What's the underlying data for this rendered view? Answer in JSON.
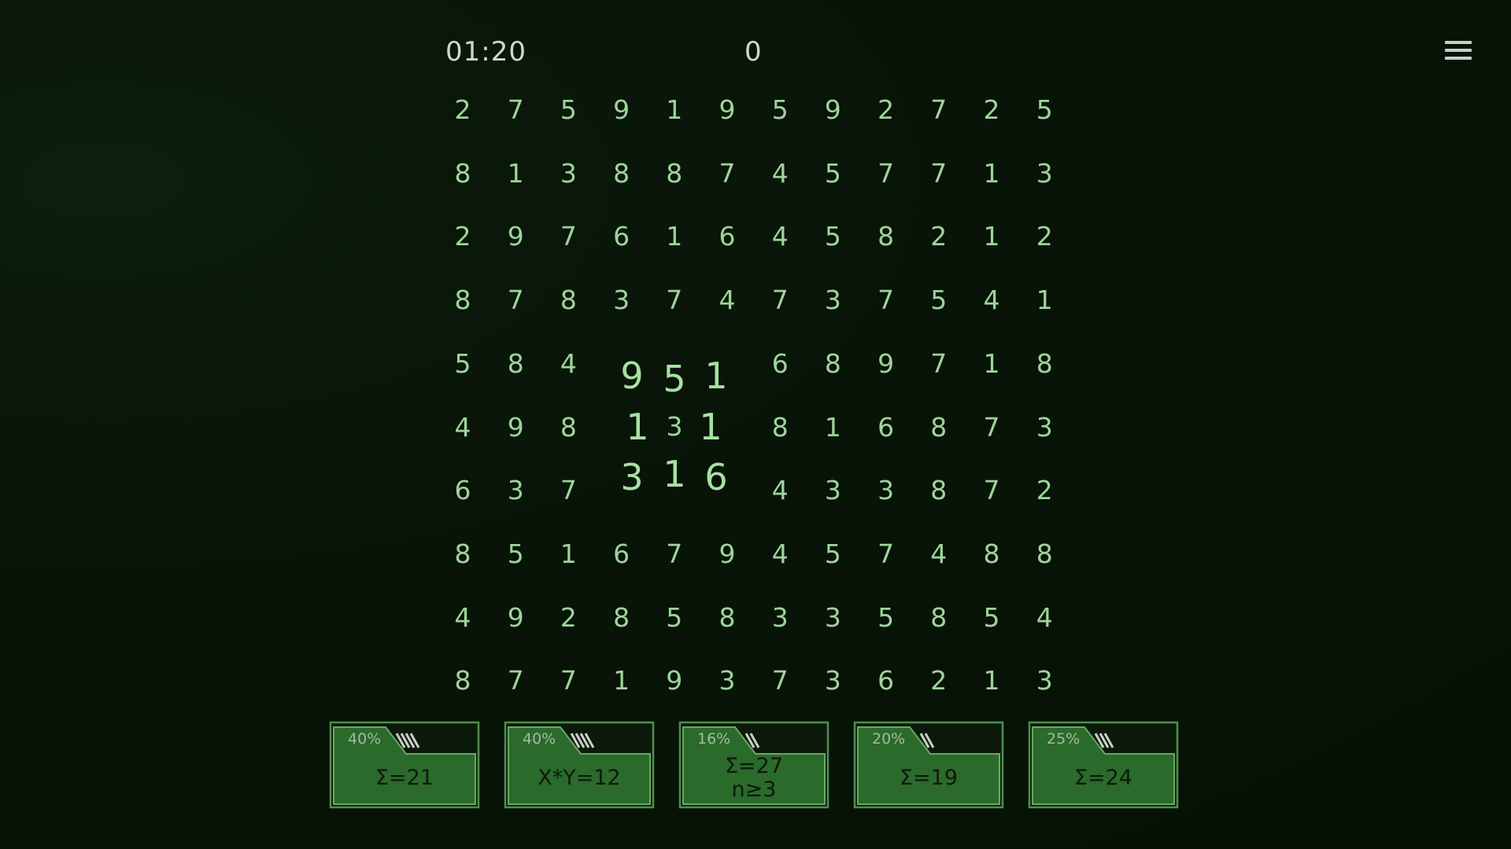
{
  "hud": {
    "timer": "01:20",
    "score": "0",
    "menu_icon": "hamburger-menu-icon"
  },
  "grid": {
    "rows": [
      [
        "2",
        "7",
        "5",
        "9",
        "1",
        "9",
        "5",
        "9",
        "2",
        "7",
        "2",
        "5"
      ],
      [
        "8",
        "1",
        "3",
        "8",
        "8",
        "7",
        "4",
        "5",
        "7",
        "7",
        "1",
        "3"
      ],
      [
        "2",
        "9",
        "7",
        "6",
        "1",
        "6",
        "4",
        "5",
        "8",
        "2",
        "1",
        "2"
      ],
      [
        "8",
        "7",
        "8",
        "3",
        "7",
        "4",
        "7",
        "3",
        "7",
        "5",
        "4",
        "1"
      ],
      [
        "5",
        "8",
        "4",
        "9",
        "5",
        "1",
        "6",
        "8",
        "9",
        "7",
        "1",
        "8"
      ],
      [
        "4",
        "9",
        "8",
        "1",
        "3",
        "1",
        "8",
        "1",
        "6",
        "8",
        "7",
        "3"
      ],
      [
        "6",
        "3",
        "7",
        "3",
        "1",
        "6",
        "4",
        "3",
        "3",
        "8",
        "7",
        "2"
      ],
      [
        "8",
        "5",
        "1",
        "6",
        "7",
        "9",
        "4",
        "5",
        "7",
        "4",
        "8",
        "8"
      ],
      [
        "4",
        "9",
        "2",
        "8",
        "5",
        "8",
        "3",
        "3",
        "5",
        "8",
        "5",
        "4"
      ],
      [
        "8",
        "7",
        "7",
        "1",
        "9",
        "3",
        "7",
        "3",
        "6",
        "2",
        "1",
        "3"
      ]
    ]
  },
  "bins": [
    {
      "percent": "40%",
      "progress": 0.4,
      "label_lines": [
        "Σ=21"
      ]
    },
    {
      "percent": "40%",
      "progress": 0.4,
      "label_lines": [
        "X*Y=12"
      ]
    },
    {
      "percent": "16%",
      "progress": 0.16,
      "label_lines": [
        "Σ=27",
        "n≥3"
      ]
    },
    {
      "percent": "20%",
      "progress": 0.2,
      "label_lines": [
        "Σ=19"
      ]
    },
    {
      "percent": "25%",
      "progress": 0.25,
      "label_lines": [
        "Σ=24"
      ]
    }
  ],
  "colors": {
    "background": "#081408",
    "digit": "#9ed49a",
    "bin_fill": "#2a6a2a",
    "bin_border": "#4f8f4b",
    "bin_tab": "#0c1a0c"
  }
}
